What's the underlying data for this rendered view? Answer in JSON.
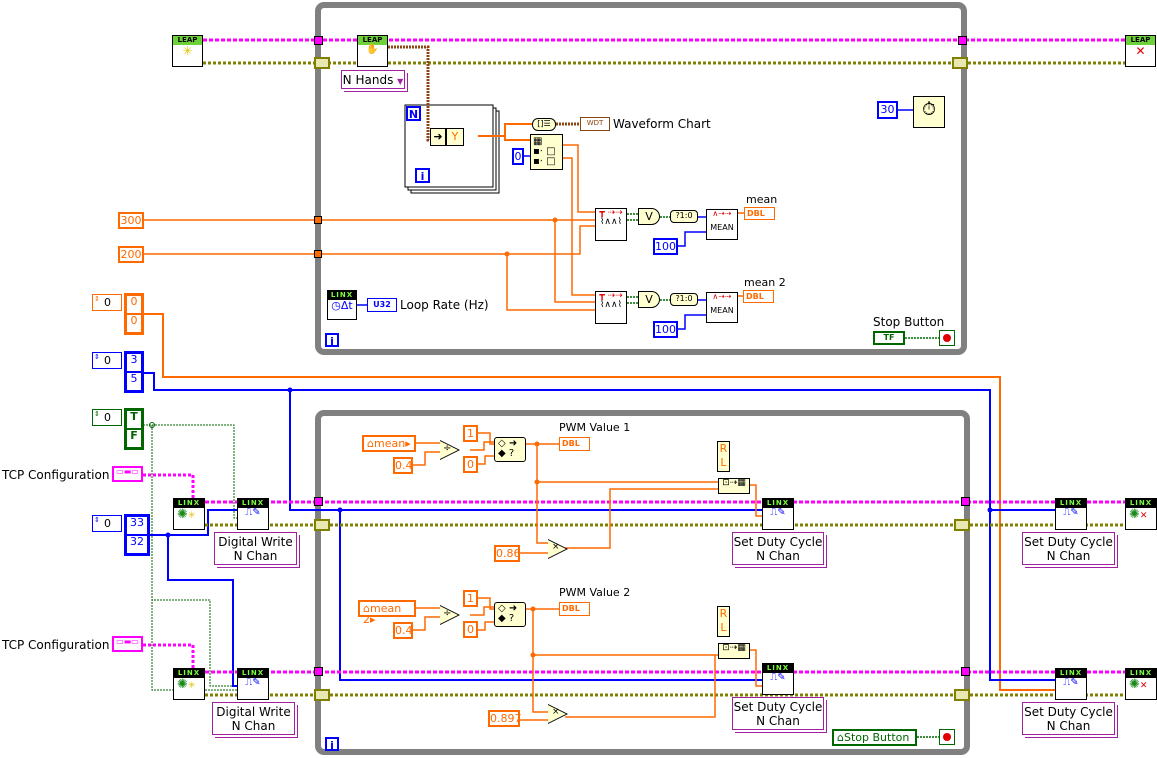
{
  "colors": {
    "numeric": "#ff6a00",
    "integer": "#0000ff",
    "boolean": "#006600",
    "cluster": "#ff00ff",
    "error": "#808000",
    "frame": "#808080",
    "array": "#8b4513"
  },
  "leap": {
    "header": "LEAP",
    "n_hands": "N Hands"
  },
  "linx": {
    "header": "LINX"
  },
  "top_loop": {
    "for_n": "N",
    "for_i": "i",
    "index_y": "Y",
    "index_const": "0",
    "waveform_chart": {
      "label": "Waveform Chart",
      "type": "WDT"
    },
    "wait_ms": "30",
    "const_300": "300",
    "const_200": "200",
    "mean_labels": [
      "mean",
      "mean 2"
    ],
    "mean_type": "DBL",
    "mean_node": "MEAN",
    "samples": [
      "100",
      "100"
    ],
    "bool_to_int": "?1:0",
    "or_glyph": "V",
    "loop_rate": {
      "label": "Loop Rate (Hz)",
      "type": "U32"
    },
    "stop": {
      "label": "Stop Button",
      "type": "TF"
    },
    "loop_i": "i"
  },
  "left": {
    "arrays": [
      {
        "index": "0",
        "values": [
          "0",
          "0"
        ],
        "color": "#ff6a00"
      },
      {
        "index": "0",
        "values": [
          "3",
          "5"
        ],
        "color": "#0000ff"
      },
      {
        "index": "0",
        "values": [
          "T",
          "F"
        ],
        "color": "#006600"
      },
      {
        "index": "0",
        "values": [
          "33",
          "32"
        ],
        "color": "#0000ff"
      }
    ],
    "tcp1": "TCP Configuration 1",
    "tcp2": "TCP Configuration 2",
    "digital_write": "Digital Write\nN Chan"
  },
  "bottom_loop": {
    "channels": [
      {
        "local": "mean",
        "divisor": "0.4",
        "one": "1",
        "zero": "0",
        "pwm_label": "PWM Value 1",
        "pwm_type": "DBL",
        "scale": "0.86",
        "rl": [
          "R",
          "L"
        ]
      },
      {
        "local": "mean 2",
        "divisor": "0.4",
        "one": "1",
        "zero": "0",
        "pwm_label": "PWM Value 2",
        "pwm_type": "DBL",
        "scale": "0.897",
        "rl": [
          "R",
          "L"
        ]
      }
    ],
    "set_duty": "Set Duty Cycle\nN Chan",
    "stop_local": "Stop Button",
    "loop_i": "i"
  }
}
